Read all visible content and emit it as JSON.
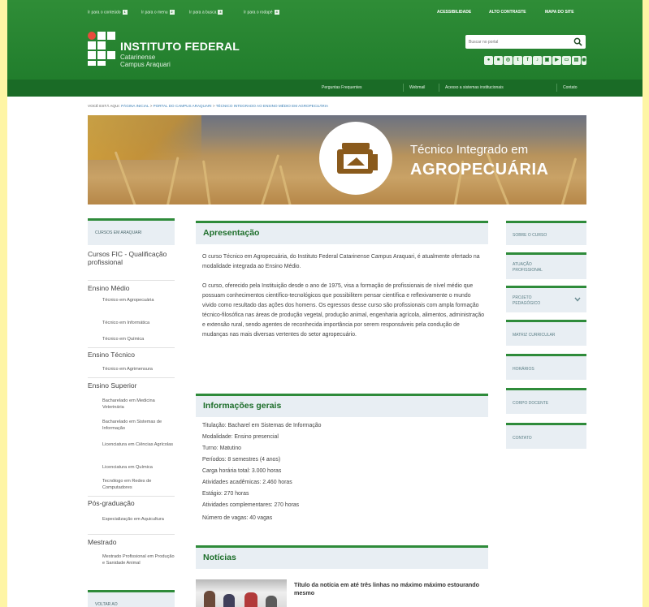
{
  "skip_links": [
    {
      "label": "Ir para o conteúdo",
      "key": "1"
    },
    {
      "label": "Ir para o menu",
      "key": "2"
    },
    {
      "label": "Ir para a busca",
      "key": "3"
    },
    {
      "label": "Ir para o rodapé",
      "key": "4"
    }
  ],
  "utility_links": [
    "ACESSIBILIDADE",
    "ALTO CONTRASTE",
    "MAPA DO SITE"
  ],
  "site": {
    "name": "INSTITUTO FEDERAL",
    "sub1": "Catarinense",
    "sub2": "Campus Araquari"
  },
  "search": {
    "placeholder": "Buscar no portal"
  },
  "social_icons": [
    "social-icon-1",
    "social-icon-2",
    "social-icon-3",
    "social-icon-4",
    "social-icon-5",
    "social-icon-6",
    "social-icon-7",
    "social-icon-8",
    "social-icon-9",
    "social-icon-10",
    "social-icon-11"
  ],
  "nav": [
    "Perguntas Frequentes",
    "Webmail",
    "Acesso a sistemas institucionais",
    "Contato"
  ],
  "breadcrumb": {
    "prefix": "VOCÊ ESTÁ AQUI:",
    "home": "PÁGINA INICIAL",
    "sep1": ">",
    "campus": "PORTAL DO CAMPUS ARAQUARI",
    "sep2": ">",
    "current": "TÉCNICO INTEGRADO AO ENSINO MÉDIO EM AGROPECUÁRIA"
  },
  "banner": {
    "line1": "Técnico Integrado em",
    "line2": "AGROPECUÁRIA"
  },
  "left_sidebar": {
    "header": "CURSOS EM ARAQUARI",
    "cat_fic": "Cursos FIC - Qualificação profissional",
    "cat_medio": "Ensino Médio",
    "medio_items": [
      "Técnico em Agropecuária",
      "Técnico em Informática",
      "Técnico em Química"
    ],
    "cat_tecnico": "Ensino Técnico",
    "tecnico_items": [
      "Técnico em Agrimensura"
    ],
    "cat_superior": "Ensino Superior",
    "superior_items": [
      "Bacharelado em Medicina Veterinária",
      "Bacharelado em Sistemas de Informação",
      "Licenciatura em Ciências Agrícolas",
      "Licenciatura em Química",
      "Tecnólogo em Redes de Computadores"
    ],
    "cat_pos": "Pós-graduação",
    "pos_items": [
      "Especialização em Aquicultura"
    ],
    "cat_mestrado": "Mestrado",
    "mestrado_items": [
      "Mestrado Profissional em Produção e Sanidade Animal"
    ],
    "back": "VOLTAR AO"
  },
  "main": {
    "apresentacao_title": "Apresentação",
    "apresentacao_p1": "O curso Técnico em Agropecuária, do Instituto Federal Catarinense Campus Araquari, é atualmente ofertado na modalidade integrada ao Ensino Médio.",
    "apresentacao_p2": "O curso, oferecido pela Instituição desde o ano de 1975, visa a formação de profissionais de nível médio que possuam conhecimentos científico-tecnológicos que possibilitem pensar científica e reflexivamente o mundo vivido como resultado das ações dos homens. Os egressos desse curso são profissionais com ampla formação técnico-filosófica nas áreas de produção vegetal, produção animal, engenharia agrícola, alimentos, administração e extensão rural, sendo agentes de reconhecida importância por serem responsáveis pela condução de mudanças nas mais diversas vertentes do setor agropecuário.",
    "info_title": "Informações gerais",
    "info": [
      "Titulação: Bacharel em Sistemas de Informação",
      "Modalidade: Ensino presencial",
      "Turno: Matutino",
      "Períodos: 8 semestres (4 anos)",
      "Carga horária total: 3.000 horas",
      "Atividades acadêmicas: 2.460 horas",
      "Estágio: 270 horas",
      "Atividades complementares: 270 horas",
      "Número de vagas: 40 vagas"
    ],
    "news_title": "Notícias",
    "news_item_title": "Título da notícia em até três linhas no máximo máximo estourando mesmo"
  },
  "right_sidebar": [
    {
      "label": "SOBRE O CURSO"
    },
    {
      "label": "ATUAÇÃO PROFISSIONAL"
    },
    {
      "label": "PROJETO PEDAGÓGICO"
    },
    {
      "label": "MATRIZ CURRICULAR"
    },
    {
      "label": "HORÁRIOS"
    },
    {
      "label": "CORPO DOCENTE"
    },
    {
      "label": "CONTATO"
    }
  ],
  "colors": {
    "header_green": "#2f8d37",
    "nav_green": "#1a6b26",
    "accent_green": "#2e8b3a",
    "box_gray": "#e8eef3",
    "frame_yellow": "#fef5a5"
  }
}
